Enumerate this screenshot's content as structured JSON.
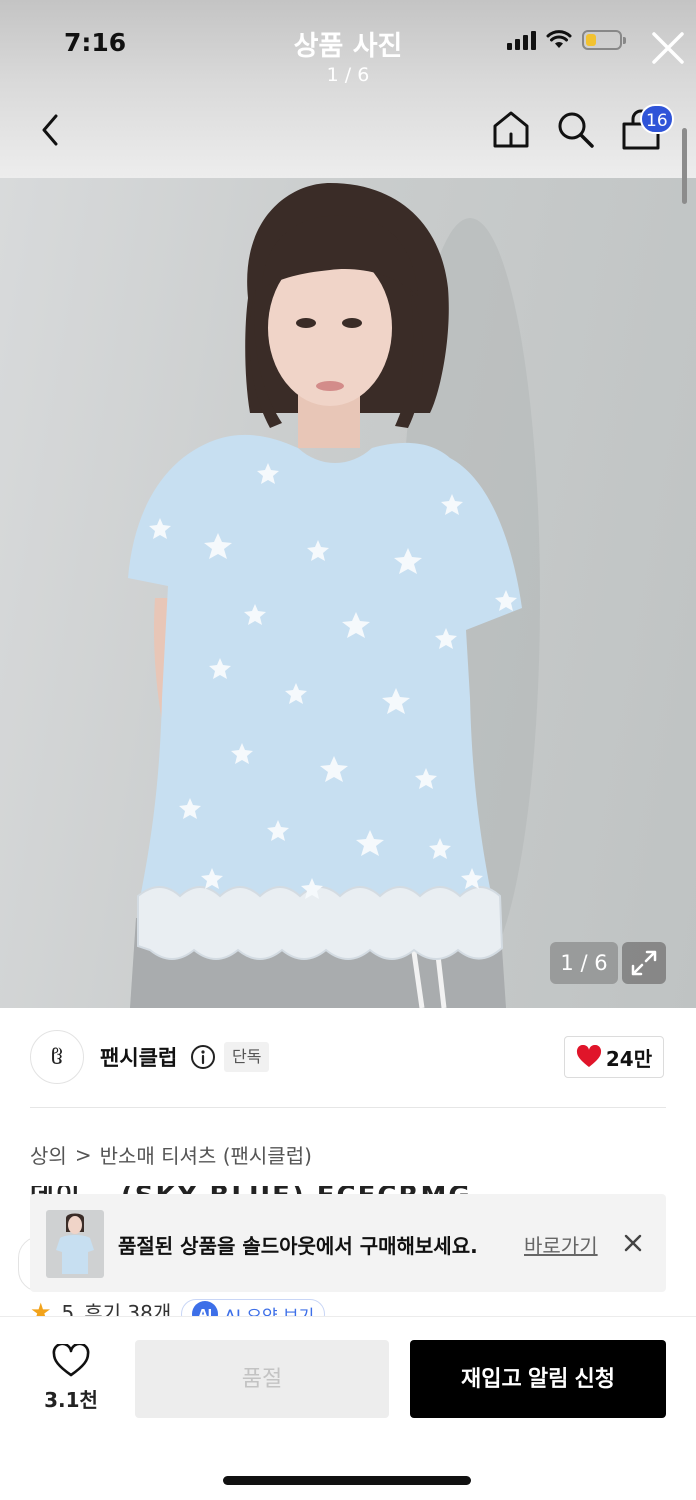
{
  "status_bar": {
    "time": "7:16"
  },
  "viewer": {
    "title": "상품 사진",
    "counter": "1 / 6"
  },
  "header": {
    "cart_count": "16"
  },
  "photo": {
    "counter": "1 / 6"
  },
  "brand": {
    "logo_text": "ჱ",
    "name": "팬시클럽",
    "exclusive_tag": "단독",
    "likes": "24만"
  },
  "breadcrumb": {
    "level1": "상의",
    "separator": ">",
    "level2": "반소매 티셔츠 (팬시클럽)"
  },
  "product": {
    "title_peek": "데이… (SKY BLUE) FCFCRMG"
  },
  "banner": {
    "message": "품절된 상품을 솔드아웃에서 구매해보세요.",
    "link_label": "바로가기"
  },
  "rating": {
    "score": "5",
    "reviews": "후기 38개",
    "ai_badge": "AI",
    "ai_label": "AI 요약 보기"
  },
  "bottom_bar": {
    "wish_count": "3.1천",
    "soldout_label": "품절",
    "restock_label": "재입고 알림 신청"
  },
  "colors": {
    "accent_blue": "#2f54d8",
    "like_red": "#e0152a",
    "cta_black": "#000000",
    "star": "#f2a31b"
  },
  "icons": [
    "back-arrow-icon",
    "home-icon",
    "search-icon",
    "shopping-bag-icon",
    "close-icon",
    "expand-icon",
    "info-icon",
    "heart-icon",
    "star-icon"
  ]
}
